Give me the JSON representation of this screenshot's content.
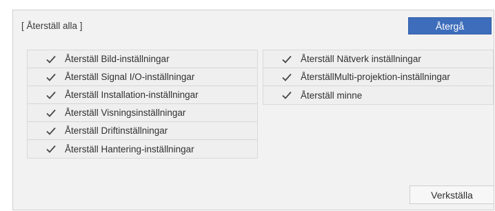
{
  "header": {
    "title": "[ Återställ alla ]",
    "back_label": "Återgå"
  },
  "left_items": [
    {
      "label": "Återställ Bild-inställningar",
      "icon": "check-icon",
      "checked": true
    },
    {
      "label": "Återställ Signal I/O-inställningar",
      "icon": "check-icon",
      "checked": true
    },
    {
      "label": "Återställ Installation-inställningar",
      "icon": "check-icon",
      "checked": true
    },
    {
      "label": "Återställ Visningsinställningar",
      "icon": "check-icon",
      "checked": true
    },
    {
      "label": "Återställ Driftinställningar",
      "icon": "check-icon",
      "checked": true
    },
    {
      "label": "Återställ Hantering-inställningar",
      "icon": "check-icon",
      "checked": true
    }
  ],
  "right_items": [
    {
      "label": "Återställ Nätverk inställningar",
      "icon": "check-icon",
      "checked": true
    },
    {
      "label": "ÅterställMulti-projektion-inställningar",
      "icon": "check-icon",
      "checked": true
    },
    {
      "label": "Återställ minne",
      "icon": "check-icon",
      "checked": true
    }
  ],
  "footer": {
    "apply_label": "Verkställa"
  },
  "colors": {
    "accent": "#3d6dbb",
    "panel_bg": "#f2f2f2",
    "row_bg": "#efefef"
  }
}
